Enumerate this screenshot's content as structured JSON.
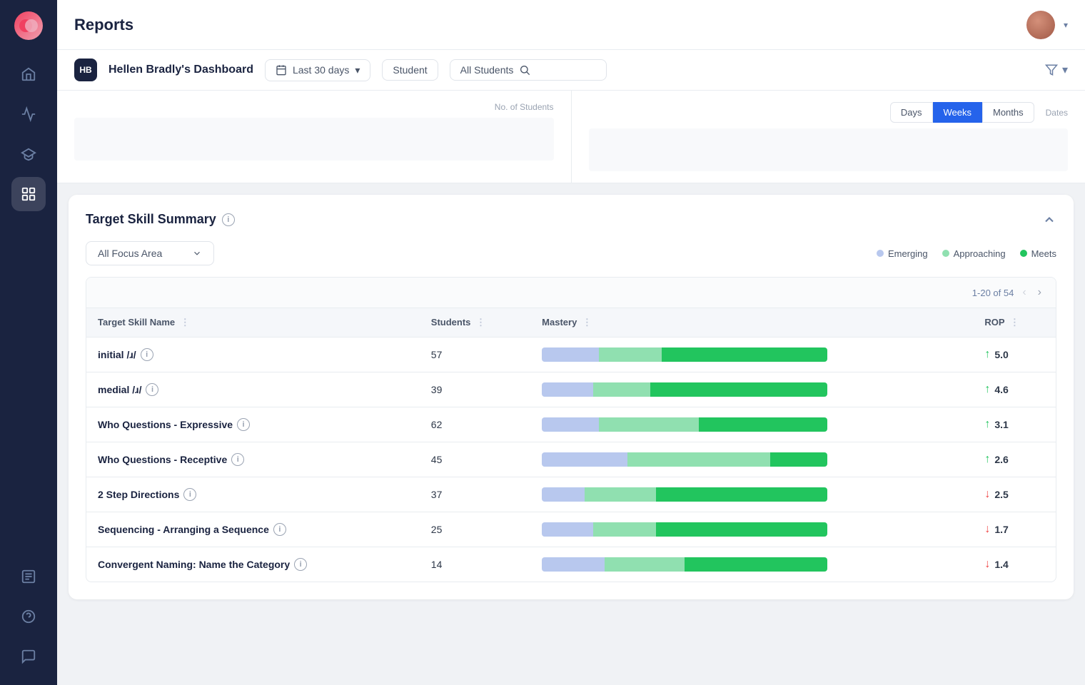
{
  "app": {
    "title": "Reports"
  },
  "sidebar": {
    "items": [
      {
        "name": "home",
        "icon": "home",
        "active": false
      },
      {
        "name": "activity",
        "icon": "activity",
        "active": false
      },
      {
        "name": "graduation",
        "icon": "graduation",
        "active": false
      },
      {
        "name": "chart",
        "icon": "chart",
        "active": true
      },
      {
        "name": "reports",
        "icon": "reports",
        "active": false
      },
      {
        "name": "help",
        "icon": "help",
        "active": false
      },
      {
        "name": "messages",
        "icon": "messages",
        "active": false
      }
    ]
  },
  "header": {
    "dashboard_badge": "HB",
    "dashboard_name": "Hellen Bradly's Dashboard",
    "date_filter": "Last 30 days",
    "student_filter_label": "Student",
    "student_search_placeholder": "All Students"
  },
  "chart_section": {
    "no_of_students_label": "No. of Students",
    "dates_label": "Dates",
    "time_buttons": [
      "Days",
      "Weeks",
      "Months"
    ],
    "active_time_button": "Weeks"
  },
  "target_skill_summary": {
    "title": "Target Skill Summary",
    "focus_area_label": "All Focus Area",
    "pagination": "1-20 of 54",
    "legend": [
      {
        "label": "Emerging",
        "color": "#b8c8ee"
      },
      {
        "label": "Approaching",
        "color": "#90e0b0"
      },
      {
        "label": "Meets",
        "color": "#22c55e"
      }
    ],
    "columns": [
      {
        "label": "Target Skill Name"
      },
      {
        "label": "Students"
      },
      {
        "label": "Mastery"
      },
      {
        "label": "ROP"
      }
    ],
    "rows": [
      {
        "skill": "initial /ɹ/",
        "students": 57,
        "emerging": 20,
        "approaching": 22,
        "meets": 58,
        "rop": 5.0,
        "rop_trend": "up"
      },
      {
        "skill": "medial /ɹ/",
        "students": 39,
        "emerging": 18,
        "approaching": 20,
        "meets": 62,
        "rop": 4.6,
        "rop_trend": "up"
      },
      {
        "skill": "Who Questions - Expressive",
        "students": 62,
        "emerging": 20,
        "approaching": 35,
        "meets": 45,
        "rop": 3.1,
        "rop_trend": "up"
      },
      {
        "skill": "Who Questions - Receptive",
        "students": 45,
        "emerging": 30,
        "approaching": 50,
        "meets": 20,
        "rop": 2.6,
        "rop_trend": "up"
      },
      {
        "skill": "2 Step Directions",
        "students": 37,
        "emerging": 15,
        "approaching": 25,
        "meets": 60,
        "rop": 2.5,
        "rop_trend": "down"
      },
      {
        "skill": "Sequencing - Arranging a Sequence",
        "students": 25,
        "emerging": 18,
        "approaching": 22,
        "meets": 60,
        "rop": 1.7,
        "rop_trend": "down"
      },
      {
        "skill": "Convergent Naming: Name the Category",
        "students": 14,
        "emerging": 22,
        "approaching": 28,
        "meets": 50,
        "rop": 1.4,
        "rop_trend": "down"
      }
    ]
  }
}
